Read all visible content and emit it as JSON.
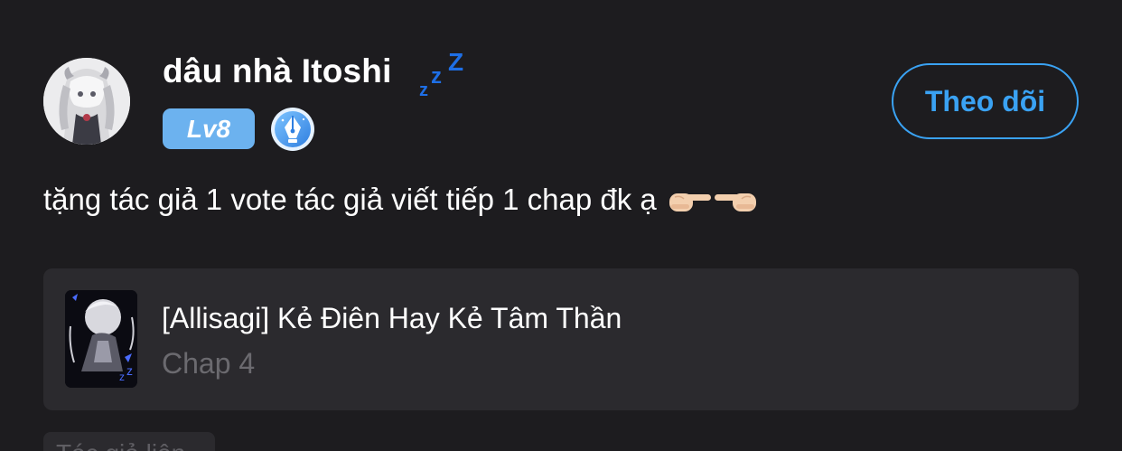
{
  "comment": {
    "author": {
      "name": "dâu nhà Itoshi",
      "status_icon": "zzz-sleep-icon",
      "level": "Lv8",
      "badge_icon": "pen-nib-writer-icon"
    },
    "follow_label": "Theo dõi",
    "text": "tặng tác giả 1 vote tác giả viết tiếp 1 chap đk ạ",
    "emoji": [
      "pointing-right-hand",
      "pointing-left-hand"
    ]
  },
  "story": {
    "title": "[Allisagi] Kẻ Điên Hay Kẻ Tâm Thần",
    "chapter": "Chap 4"
  },
  "reply": {
    "placeholder": "Tác giả liên..."
  },
  "colors": {
    "background": "#1d1c1f",
    "card": "#2b2a2e",
    "accent": "#3aa2f3",
    "level_badge": "#6cb2ef",
    "muted_text": "#6b6a6f"
  }
}
